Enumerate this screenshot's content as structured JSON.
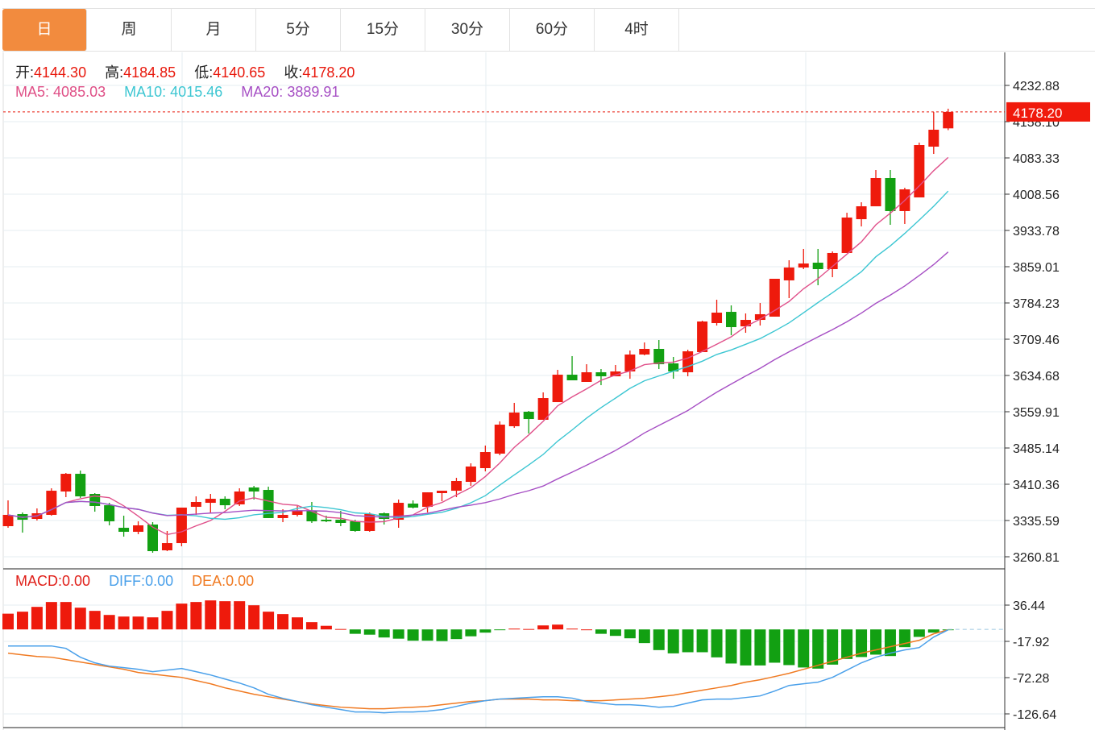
{
  "tabs": [
    {
      "label": "日",
      "active": true
    },
    {
      "label": "周"
    },
    {
      "label": "月"
    },
    {
      "label": "5分"
    },
    {
      "label": "15分"
    },
    {
      "label": "30分"
    },
    {
      "label": "60分"
    },
    {
      "label": "4时"
    }
  ],
  "ohlc_info": {
    "open_label": "开:",
    "open": "4144.30",
    "high_label": "高:",
    "high": "4184.85",
    "low_label": "低:",
    "low": "4140.65",
    "close_label": "收:",
    "close": "4178.20"
  },
  "ma_info": {
    "ma5_label": "MA5:",
    "ma5": "4085.03",
    "ma10_label": "MA10:",
    "ma10": "4015.46",
    "ma20_label": "MA20:",
    "ma20": "3889.91"
  },
  "macd_info": {
    "macd_label": "MACD:",
    "macd": "0.00",
    "diff_label": "DIFF:",
    "diff": "0.00",
    "dea_label": "DEA:",
    "dea": "0.00"
  },
  "current_price_label": "4178.20",
  "colors": {
    "up": "#EE1A0C",
    "down": "#12A012",
    "ma5": "#E0508A",
    "ma10": "#3CC6D2",
    "ma20": "#A64FC4",
    "diff": "#4AA0EA",
    "dea": "#F07A22",
    "tab_active": "#F28B3E",
    "grid": "#E6EDF2"
  },
  "chart_data": [
    {
      "type": "candlestick",
      "y_ticks": [
        "4232.88",
        "4158.10",
        "4083.33",
        "4008.56",
        "3933.78",
        "3859.01",
        "3784.23",
        "3709.46",
        "3634.68",
        "3559.91",
        "3485.14",
        "3410.36",
        "3335.59",
        "3260.81"
      ],
      "ylim": [
        3260.81,
        4232.88
      ],
      "grid": true,
      "candles": [
        [
          3323.9,
          3347.2,
          3377.1,
          3320.6
        ],
        [
          3348.9,
          3337.2,
          3352.2,
          3310.6
        ],
        [
          3338.9,
          3350.5,
          3360.5,
          3335.6
        ],
        [
          3347.2,
          3397.0,
          3402.0,
          3345.5
        ],
        [
          3395.4,
          3431.9,
          3433.6,
          3383.8
        ],
        [
          3431.9,
          3385.4,
          3438.6,
          3382.1
        ],
        [
          3390.4,
          3365.5,
          3392.1,
          3353.8
        ],
        [
          3367.1,
          3333.9,
          3372.1,
          3325.6
        ],
        [
          3320.6,
          3312.3,
          3345.5,
          3302.3
        ],
        [
          3312.3,
          3325.6,
          3333.9,
          3307.3
        ],
        [
          3327.3,
          3272.4,
          3332.2,
          3269.1
        ],
        [
          3274.1,
          3289.0,
          3314.0,
          3272.4
        ],
        [
          3289.0,
          3362.2,
          3362.2,
          3282.4
        ],
        [
          3363.8,
          3373.8,
          3385.4,
          3347.2
        ],
        [
          3372.1,
          3380.4,
          3390.4,
          3350.5
        ],
        [
          3380.4,
          3367.1,
          3385.4,
          3358.8
        ],
        [
          3368.8,
          3395.4,
          3402.0,
          3365.5
        ],
        [
          3403.7,
          3395.4,
          3407.0,
          3378.8
        ],
        [
          3398.7,
          3340.6,
          3405.4,
          3340.6
        ],
        [
          3340.6,
          3347.2,
          3358.8,
          3332.2
        ],
        [
          3347.2,
          3355.5,
          3365.5,
          3343.9
        ],
        [
          3355.5,
          3333.9,
          3373.8,
          3330.6
        ],
        [
          3337.2,
          3333.9,
          3345.5,
          3332.2
        ],
        [
          3337.2,
          3330.6,
          3355.5,
          3323.9
        ],
        [
          3333.9,
          3314.0,
          3337.2,
          3312.3
        ],
        [
          3314.0,
          3348.9,
          3352.2,
          3312.3
        ],
        [
          3350.5,
          3338.9,
          3352.2,
          3327.3
        ],
        [
          3337.2,
          3372.1,
          3378.8,
          3320.6
        ],
        [
          3370.5,
          3362.2,
          3377.1,
          3360.5
        ],
        [
          3363.8,
          3393.7,
          3393.7,
          3352.2
        ],
        [
          3392.1,
          3397.0,
          3397.0,
          3375.4
        ],
        [
          3397.0,
          3417.0,
          3423.6,
          3383.8
        ],
        [
          3415.3,
          3446.9,
          3453.5,
          3407.0
        ],
        [
          3443.6,
          3476.8,
          3490.1,
          3436.9
        ],
        [
          3473.5,
          3533.3,
          3540.0,
          3470.2
        ],
        [
          3530.0,
          3558.2,
          3578.2,
          3526.7
        ],
        [
          3559.9,
          3544.9,
          3561.6,
          3515.0
        ],
        [
          3543.3,
          3588.1,
          3599.8,
          3543.3
        ],
        [
          3579.8,
          3636.3,
          3646.3,
          3579.8
        ],
        [
          3636.3,
          3624.7,
          3674.6,
          3624.7
        ],
        [
          3621.4,
          3641.3,
          3657.9,
          3621.4
        ],
        [
          3641.3,
          3633.0,
          3648.0,
          3614.7
        ],
        [
          3633.0,
          3643.0,
          3656.3,
          3633.0
        ],
        [
          3643.0,
          3677.9,
          3686.2,
          3628.0
        ],
        [
          3677.9,
          3689.5,
          3702.8,
          3676.2
        ],
        [
          3689.5,
          3657.9,
          3707.8,
          3648.0
        ],
        [
          3659.6,
          3643.0,
          3672.9,
          3628.0
        ],
        [
          3641.3,
          3684.5,
          3687.8,
          3633.0
        ],
        [
          3682.9,
          3746.0,
          3747.7,
          3682.9
        ],
        [
          3742.7,
          3764.3,
          3790.9,
          3737.7
        ],
        [
          3765.9,
          3734.4,
          3779.2,
          3717.8
        ],
        [
          3736.0,
          3749.3,
          3762.6,
          3722.7
        ],
        [
          3749.3,
          3761.0,
          3784.2,
          3737.7
        ],
        [
          3756.0,
          3834.1,
          3834.1,
          3756.0
        ],
        [
          3830.8,
          3857.3,
          3872.3,
          3794.2
        ],
        [
          3857.3,
          3865.6,
          3895.6,
          3854.0
        ],
        [
          3867.3,
          3854.0,
          3895.6,
          3820.8
        ],
        [
          3854.0,
          3887.3,
          3890.6,
          3837.4
        ],
        [
          3887.3,
          3960.4,
          3970.3,
          3887.3
        ],
        [
          3957.0,
          3983.6,
          3991.9,
          3942.1
        ],
        [
          3983.6,
          4041.8,
          4058.4,
          3983.6
        ],
        [
          4041.8,
          3973.7,
          4058.4,
          3945.4
        ],
        [
          3973.7,
          4018.5,
          4021.8,
          3947.1
        ],
        [
          4001.9,
          4109.9,
          4114.9,
          4001.9
        ],
        [
          4106.6,
          4141.5,
          4178.0,
          4091.6
        ],
        [
          4144.3,
          4178.2,
          4184.85,
          4140.65
        ]
      ],
      "candle_fields": [
        "open",
        "close",
        "high",
        "low"
      ],
      "moving_averages": [
        "MA5",
        "MA10",
        "MA20"
      ],
      "current_price": 4178.2
    },
    {
      "type": "bar+line",
      "y_ticks": [
        "36.44",
        "-17.92",
        "-72.28",
        "-126.64"
      ],
      "macd": [
        23.6,
        26.6,
        33.8,
        41.1,
        41.1,
        32.6,
        27.8,
        21.7,
        19.3,
        19.3,
        18.1,
        27.8,
        38.7,
        41.1,
        43.5,
        42.3,
        42.3,
        36.2,
        26.6,
        23.0,
        18.1,
        10.9,
        5.4,
        0.6,
        -6.6,
        -7.9,
        -12.1,
        -13.9,
        -16.9,
        -16.9,
        -17.5,
        -14.5,
        -10.3,
        -4.8,
        -0.6,
        1.2,
        0.6,
        6.0,
        7.2,
        1.2,
        0.0,
        -6.6,
        -9.7,
        -13.3,
        -20.5,
        -31.0,
        -35.9,
        -34.2,
        -34.2,
        -41.9,
        -51.1,
        -54.0,
        -54.0,
        -49.9,
        -53.5,
        -57.1,
        -58.8,
        -52.8,
        -44.3,
        -41.4,
        -37.8,
        -39.9,
        -26.6,
        -11.2,
        -4.8,
        -0.6
      ],
      "diff": [
        -24.8,
        -24.8,
        -24.8,
        -24.8,
        -28.4,
        -41.7,
        -50.1,
        -55.0,
        -57.4,
        -59.8,
        -63.4,
        -61.0,
        -58.6,
        -63.4,
        -68.3,
        -74.4,
        -80.4,
        -87.6,
        -97.3,
        -103.3,
        -108.1,
        -112.9,
        -116.6,
        -120.2,
        -123.8,
        -123.8,
        -125.0,
        -123.8,
        -123.8,
        -122.6,
        -120.2,
        -115.4,
        -110.5,
        -106.9,
        -104.5,
        -103.3,
        -102.0,
        -101.0,
        -101.0,
        -103.0,
        -108.1,
        -110.5,
        -112.9,
        -112.9,
        -114.2,
        -116.6,
        -115.4,
        -110.5,
        -105.7,
        -104.5,
        -104.5,
        -102.1,
        -99.7,
        -92.4,
        -84.0,
        -81.5,
        -79.1,
        -71.9,
        -61.0,
        -50.1,
        -41.7,
        -35.6,
        -30.8,
        -27.2,
        -11.5,
        -0.6
      ],
      "dea": [
        -35.6,
        -38.1,
        -40.5,
        -41.7,
        -45.3,
        -48.9,
        -52.5,
        -56.2,
        -59.8,
        -64.6,
        -67.0,
        -69.5,
        -71.9,
        -76.7,
        -81.5,
        -87.6,
        -92.4,
        -97.2,
        -100.9,
        -104.5,
        -108.1,
        -111.7,
        -114.2,
        -116.6,
        -117.8,
        -119.0,
        -119.0,
        -117.8,
        -116.6,
        -115.4,
        -112.9,
        -110.5,
        -108.1,
        -106.9,
        -104.5,
        -104.5,
        -104.5,
        -105.7,
        -105.7,
        -106.9,
        -106.9,
        -106.9,
        -105.7,
        -104.5,
        -103.3,
        -100.9,
        -98.5,
        -94.8,
        -91.2,
        -87.6,
        -84.0,
        -79.1,
        -75.5,
        -70.7,
        -65.8,
        -59.8,
        -53.8,
        -47.8,
        -41.7,
        -35.6,
        -30.8,
        -25.9,
        -21.1,
        -16.3,
        -6.6,
        -0.6
      ],
      "grid": true
    }
  ]
}
